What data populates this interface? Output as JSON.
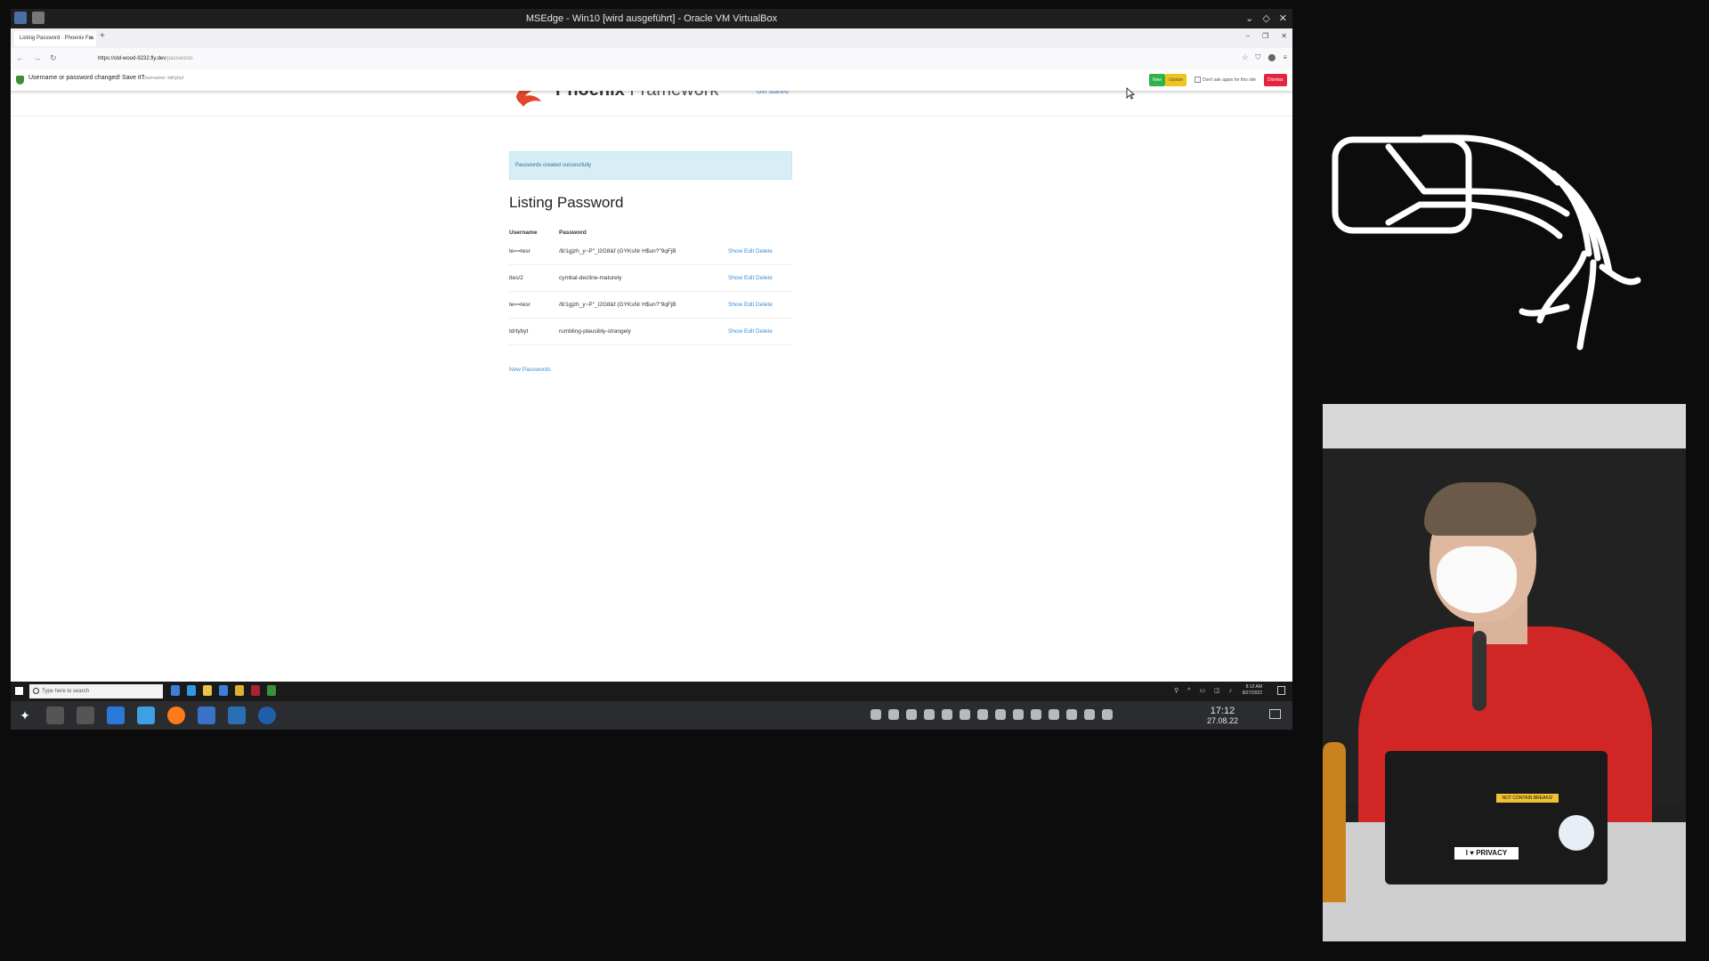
{
  "vbox": {
    "title": "MSEdge - Win10 [wird ausgeführt] - Oracle VM VirtualBox",
    "controls": [
      "⌄",
      "◇",
      "✕"
    ]
  },
  "browser": {
    "tab_title": "Listing Password · Phoenix Fra",
    "tab_close": "×",
    "new_tab": "+",
    "window_controls": [
      "–",
      "❐",
      "✕"
    ],
    "nav": [
      "←",
      "→",
      "↻"
    ],
    "url_host": "https://old-wood-9232.fly.dev",
    "url_path": "/passwords",
    "toolbar_icons": [
      "☆",
      "⛉",
      "⬤",
      "≡"
    ]
  },
  "password_bar": {
    "message": "Username or password changed! Save it?",
    "username": "Username: tdrtybyt",
    "new_label": "New",
    "update_label": "Update",
    "dont_ask_label": "Don't ask again for this site",
    "dismiss_label": "Dismiss"
  },
  "page": {
    "brand_bold": "Phoenix",
    "brand_light": " Framework",
    "get_started": "Get Started",
    "alert": "Passwords created successfully",
    "heading": "Listing Password",
    "columns": [
      "Username",
      "Password"
    ],
    "rows": [
      {
        "username": "te==tesr",
        "password": "/8/1gjzh_y~P\"_l2G8&f (GYKsNr H$un?\"9qFjB",
        "actions": "Show Edit Delete"
      },
      {
        "username": "ttes/2",
        "password": "cymbal-decline-maturely",
        "actions": "Show Edit Delete"
      },
      {
        "username": "te==tesr",
        "password": "/8/1gjzh_y~P\"_l2G8&f (GYKsNr H$un?\"9qFjB",
        "actions": "Show Edit Delete"
      },
      {
        "username": "tdrtybyt",
        "password": "rumbling-plausibly-strangely",
        "actions": "Show Edit Delete"
      }
    ],
    "new_link": "New Passwords"
  },
  "windows_taskbar": {
    "search_placeholder": "Type here to search",
    "tray_time": "8:12 AM",
    "tray_date": "8/27/2022"
  },
  "kde_panel": {
    "time": "17:12",
    "date": "27.08.22"
  },
  "speaker_stickers": {
    "privacy": "I ♥ PRIVACY",
    "yellow": "NOT CONTAIN BREAKS!"
  },
  "colors": {
    "link": "#3a8fd6",
    "alert_bg": "#d9edf7",
    "new_btn": "#2fb24a",
    "update_btn": "#f0c419",
    "dismiss_btn": "#e4253f",
    "phoenix_orange": "#e0462a"
  }
}
